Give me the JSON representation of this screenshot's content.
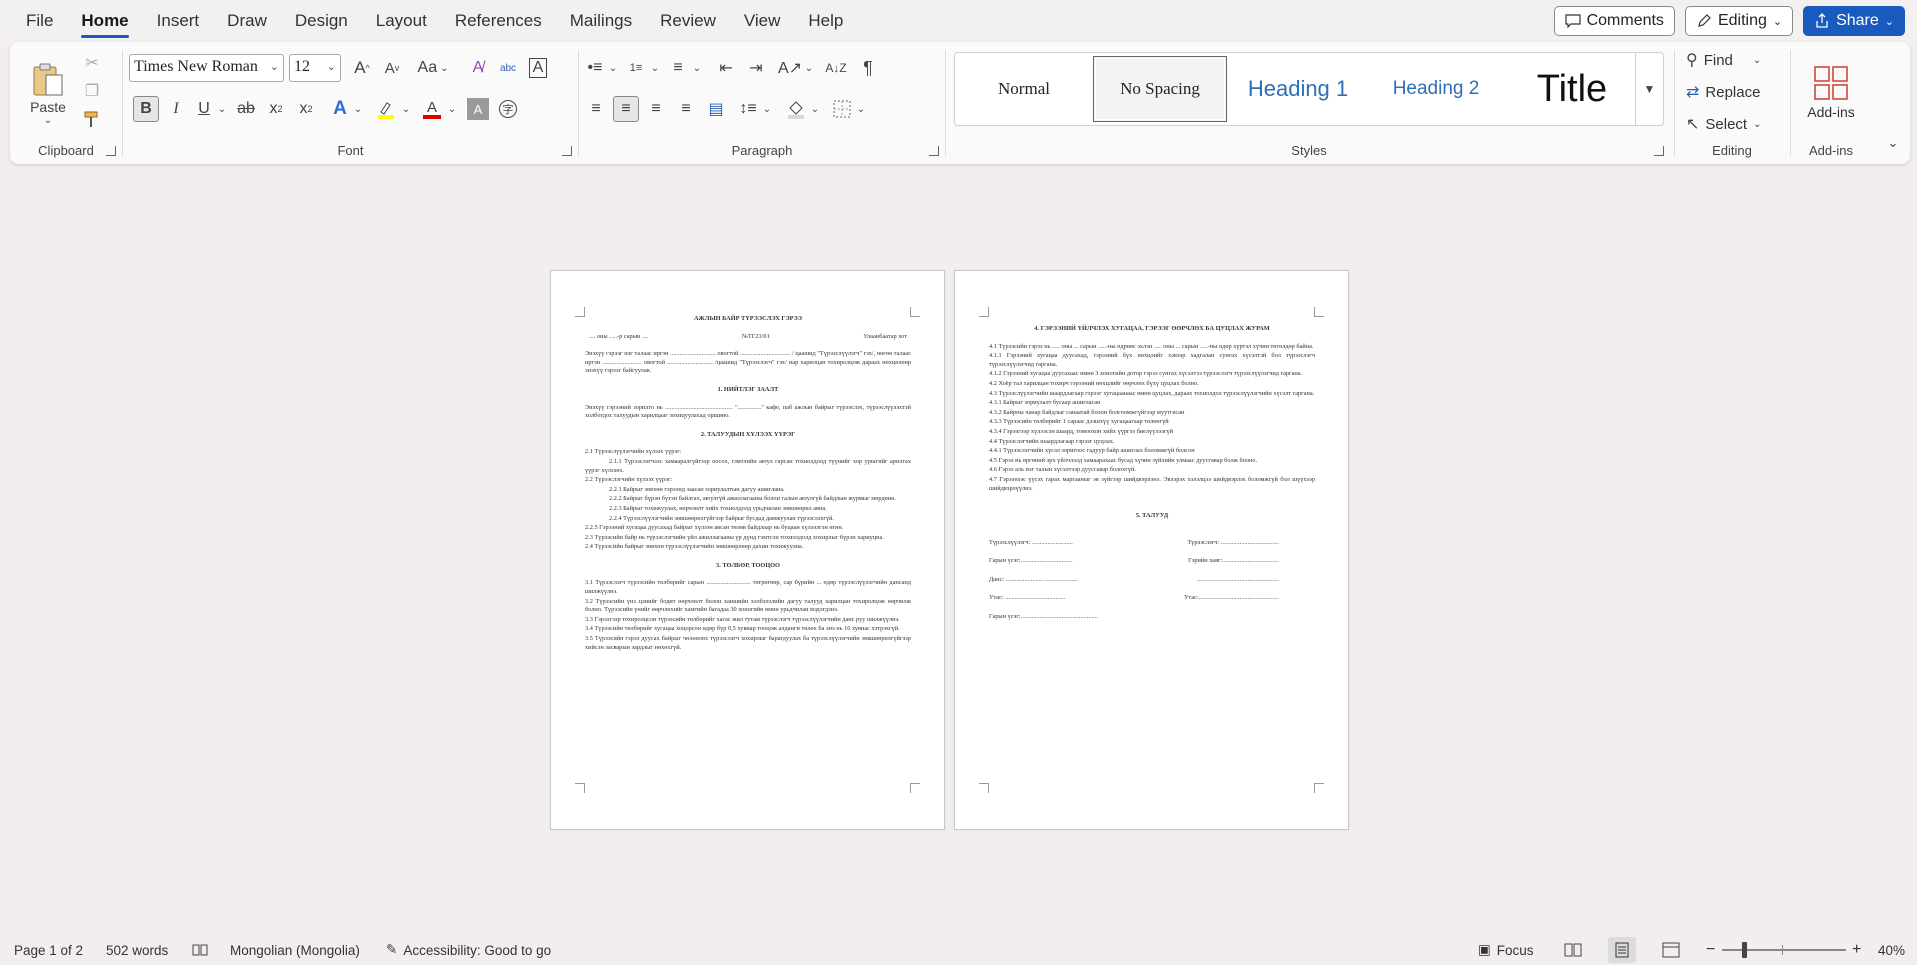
{
  "menu": {
    "tabs": [
      "File",
      "Home",
      "Insert",
      "Draw",
      "Design",
      "Layout",
      "References",
      "Mailings",
      "Review",
      "View",
      "Help"
    ],
    "active": "Home",
    "comments": "Comments",
    "editing": "Editing",
    "share": "Share"
  },
  "ribbon": {
    "clipboard": {
      "paste": "Paste",
      "label": "Clipboard"
    },
    "font": {
      "name": "Times New Roman",
      "size": "12",
      "case": "Aa",
      "label": "Font"
    },
    "paragraph": {
      "label": "Paragraph"
    },
    "styles": {
      "items": [
        "Normal",
        "No Spacing",
        "Heading 1",
        "Heading 2",
        "Title"
      ],
      "selected": "No Spacing",
      "label": "Styles"
    },
    "editing": {
      "find": "Find",
      "replace": "Replace",
      "select": "Select",
      "label": "Editing"
    },
    "addins": {
      "button": "Add-ins",
      "label": "Add-ins"
    },
    "colors": {
      "accent": "#185abd",
      "highlight": "#ffff00",
      "font_color": "#e00000"
    }
  },
  "document": {
    "page1": {
      "title": "АЖЛЫН БАЙР ТҮРЭЭСЛЭХ ГЭРЭЭ",
      "meta_left": ".... оны .....-р сарын ....",
      "meta_mid": "№ТГ21/01",
      "meta_right": "Улаанбаатар хот",
      "intro": "Энэхүү гэрээг нэг талаас иргэн ............................. овогтой ................................ / цаашид \"Түрээслүүлэгч\" гэх/, нөгөө талаас иргэн ......................... овогтой ............................. /цаашид \"Түрээслэгч\" гэх/ нар харилцан тохиролцож дараах нөхцөлөөр энэхүү гэрээг байгуулав.",
      "s1": "1. НИЙТЛЭГ ЗААЛТ",
      "s1_text": "Энэхүү гэрээний зорилго нь ........................................... \"...............\" кафе, паб ажлын байрыг түрээслэх, түрээслүүлэхтэй холбогдох талуудын харилцааг зохицуулахад оршино.",
      "s2": "2. ТАЛУУДЫН ХҮЛЭЭХ ҮҮРЭГ",
      "s2_lines": [
        "2.1 Түрээслүүлэгчийн хүлээх үүрэг:",
        "2.1.1 Түрээслэгчээс хамааралгүйгээр оосол, гэмтлийн аюул гарсан тохиолдолд түүнийг хор уршгийг арилгах үүрэг хүлээнэ.",
        "2.2 Түрээслэгчийн хүлээх үүрэг:",
        "2.2.1 Байрыг зөвхөн гэрээнд заасан зориулалтын дагуу ашиглана.",
        "2.2.2 Байрыг бүрэн бүтэн байлгах, аюулгүй ажиллагааны болон галын аюулгүй байдлын журмыг мөрдөнө.",
        "2.2.3 Байрыг тохижуулах, өөрчлөлт хийх тохиолдолд урьдчилан зөвшөөрөл авна.",
        "2.2.4 Түрээслүүлэгчийн зөвшөөрөлгүйгээр байрыг бусдад дамжуулан түрээслэхгүй.",
        "2.2.5 Гэрээний хугацаа дуусахад байрыг хүлээн авсан төлөв байдлаар нь буцаан хүлээлгэн өгнө.",
        "2.3 Түрээсийн байр нь түрээслэгчийн үйл ажиллагааны үр дүнд гэмтсэн тохиолдолд хохирлыг бүрэн хариуцна.",
        "2.4 Түрээсийн байрыг зөвхөн түрээслүүлэгчийн зөвшөөрлөөр дахин тохижуулна."
      ],
      "s3": "3. ТӨЛБӨР, ТООЦОО",
      "s3_lines": [
        "3.1 Түрээслэгч түрээсийн төлбөрийг сарын ............................ төгрөгөөр, сар бүрийн ... өдөр түрээслүүлэгчийн дансанд шилжүүлнэ.",
        "3.2 Түрээсийн үнэ цэнийг бодит өөрчлөлт болон ханшийн хэлбэлзлийн дагуу талууд харилцан тохиролцож өөрчилж болно. Түрээсийн үнийг өөрчлөхийг хамгийн багадаа 30 хоногийн өмнө урьдчилан мэдэгдэнэ.",
        "3.3 Гэрээгээр тохиролцсон түрээсийн төлбөрийг хагас жил тутам түрээслэгч түрээслүүлэгчийн данс руу шилжүүлнэ.",
        "3.4 Түрээсийн төлбөрийг хугацаа хоцорсон өдөр бүр 0,5 хувиар тооцож алданги төлөх ба энэ нь 10 хувиас хэтрэхгүй.",
        "3.5 Түрээсийн гэрээ дуусах байрыг чөлөөлөх түрээслэгч хохирлыг барагдуулах ба түрээслүүлэгчийн зөвшөөрөлгүйгээр хийсэн засварын зардлыг нөхөхгүй."
      ]
    },
    "page2": {
      "s4": "4. ГЭРЭЭНИЙ ҮЙЛЧЛЭХ ХУГАЦАА, ГЭРЭЭГ ӨӨРЧЛӨХ БА ЦУЦЛАХ ЖУРАМ",
      "s4_lines": [
        "4.1 Түрээсийн гэрээ нь ..... оны ... сарын .....-ны өдрөөс эхлэн ..... оны ... сарын .....-ны өдөр хүртэл хүчин төгөлдөр байна.",
        "4.1.1 Гэрээний хугацаа дуусахад, гэрээний бүх нөхцлийг хэвээр хадгалан сунгах хүсэлтэй бол түрээслэгч түрээслүүлэгчид гаргана.",
        "4.1.2 Гэрээний хугацаа дуусахаас өмнө 3 хоногийн дотор гэрээ сунгах хүсэлтээ түрээслэгч түрээслүүлэгчид гаргана.",
        "4.2 Хоёр тал харилцан тохирч гэрээний нөхцлийг өөрчлөх бүхү цуцлах болно.",
        "4.3 Түрээслүүлэгчийн шаардлагаар гэрээг хугацаанаас өмнө цуцлах, дараах тохиолдол түрээслүүлэгчийн хүсэлт гаргана.",
        "4.3.1 Байрыг зориулалт бусаар ашигласан",
        "4.3.2 Байрны чанар байдлыг санаатай болон болгоомжгүйгээр муутгасан",
        "4.3.3 Түрээсийн төлбөрийг 1 сараас дээшхүү хугацаагаар төлөөгүй",
        "4.3.4 Гэрээгээр хүлээсэн шаард, томоохон хийх үүргээ биелүүлээгүй",
        "4.4 Түрээслэгчийн шаардлагаар гэрээг цуцлах.",
        "4.4.1 Түрээслэгчийн хүсэл зоригоос гадуур байр ашиглах боломжгүй болсон",
        "4.5 Гэрээ нь өргөний эрх үйлчлэлд хамаарахаас бусад хүчин зүйлийн улмаас дуусгавар болж болно.",
        "4.6 Гэрээ аль нэг талын хүсэлтээр дуусгавар болохгүй.",
        "4.7 Гэрээнээс үүсэх гарах маргааныг эв зүйгээр шийдвэрлэнэ. Эвлэрэх хэлэлцээ шийдвэрлэх боломжгүй бол шүүхээр шийдвэрлүүлнэ."
      ],
      "s5": "5. ТАЛУУД",
      "sig_rows": [
        [
          "Түрээслүүлэгч: ..........................",
          "Түрээслэгч: ....................................."
        ],
        [
          "Гарын үсэг:.................................",
          "Гэрийн хаяг:...................................."
        ],
        [
          "Данс: ........................ .....................",
          "...................................................."
        ],
        [
          "Утас: ......................................",
          "Утас:..................................................."
        ],
        [
          "Гарын үсэг:.................................................",
          ""
        ]
      ]
    }
  },
  "status": {
    "page": "Page 1 of 2",
    "words": "502 words",
    "language": "Mongolian (Mongolia)",
    "accessibility": "Accessibility: Good to go",
    "focus": "Focus",
    "zoom": "40%"
  }
}
